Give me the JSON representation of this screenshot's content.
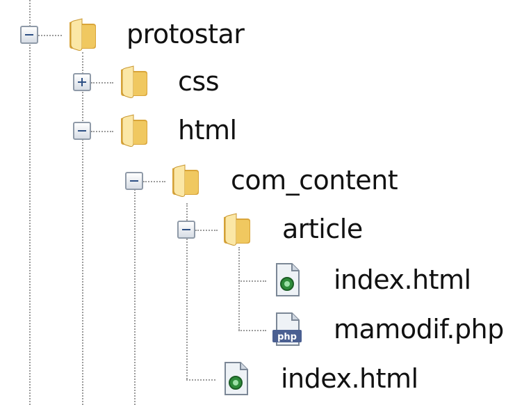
{
  "tree": {
    "nodes": [
      {
        "label": "protostar",
        "icon": "folder-icon",
        "toggle": "collapse"
      },
      {
        "label": "css",
        "icon": "folder-icon",
        "toggle": "expand"
      },
      {
        "label": "html",
        "icon": "folder-icon",
        "toggle": "collapse"
      },
      {
        "label": "com_content",
        "icon": "folder-icon",
        "toggle": "collapse"
      },
      {
        "label": "article",
        "icon": "folder-icon",
        "toggle": "collapse"
      },
      {
        "label": "index.html",
        "icon": "html-file-icon",
        "toggle": ""
      },
      {
        "label": "mamodif.php",
        "icon": "php-file-icon",
        "toggle": ""
      },
      {
        "label": "index.html",
        "icon": "html-file-icon",
        "toggle": ""
      }
    ]
  },
  "colors": {
    "folder_light": "#fbe7a6",
    "folder_dark": "#d9a53a",
    "toggle_border": "#8f9aa8",
    "dotted_line": "#9a9a9a",
    "html_badge": "#2e8b3a",
    "php_badge": "#4a5f91"
  }
}
